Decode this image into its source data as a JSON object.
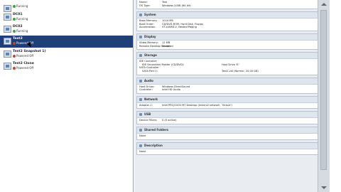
{
  "vm_list": [
    {
      "name": "",
      "state": "Running",
      "status": "run"
    },
    {
      "name": "DC01",
      "state": "Running",
      "status": "run"
    },
    {
      "name": "DC02",
      "state": "Running",
      "status": "run"
    },
    {
      "name": "Test2",
      "state": "Powered Off",
      "status": "off"
    },
    {
      "name": "Test2 Snapshot 1)",
      "state": "Powered Off",
      "status": "off"
    },
    {
      "name": "Test2 Clone",
      "state": "Powered Off",
      "status": "off"
    }
  ],
  "details": {
    "general": {
      "rows": [
        [
          "Name:",
          "Test"
        ],
        [
          "OS Type:",
          "Windows 2008 (64 bit)"
        ]
      ]
    },
    "system": {
      "title": "System",
      "rows": [
        [
          "Base Memory:",
          "1024 MB"
        ],
        [
          "Boot Order:",
          "CD/DVD-ROM, Hard Disk, Floppy"
        ],
        [
          "Acceleration:",
          "VT-x/AMD-V, Nested Paging"
        ]
      ]
    },
    "display": {
      "title": "Display",
      "rows": [
        [
          "Video Memory:",
          "12 MB"
        ],
        [
          "Remote Desktop Server:",
          "Disabled"
        ]
      ]
    },
    "storage": {
      "title": "Storage",
      "rows": [
        [
          "IDE Controller",
          ""
        ],
        [
          "IDE Secondary Master (CD/DVD):",
          "Host Drive 'E:'"
        ],
        [
          "SATA Controller",
          ""
        ],
        [
          "SATA Port 0:",
          "Test2.vdi (Normal, 20.00 GB)"
        ]
      ]
    },
    "audio": {
      "title": "Audio",
      "rows": [
        [
          "Host Driver:",
          "Windows DirectSound"
        ],
        [
          "Controller:",
          "Intel HD Audio"
        ]
      ]
    },
    "network": {
      "title": "Network",
      "rows": [
        [
          "Adapter 1:",
          "Intel PRO/1000 MT Desktop (Internal network, 'Virtual')"
        ]
      ]
    },
    "usb": {
      "title": "USB",
      "rows": [
        [
          "Device Filters:",
          "0 (0 active)"
        ]
      ]
    },
    "shared": {
      "title": "Shared Folders",
      "rows": [
        [
          "None",
          ""
        ]
      ]
    },
    "description": {
      "title": "Description",
      "rows": [
        [
          "None",
          ""
        ]
      ]
    }
  }
}
